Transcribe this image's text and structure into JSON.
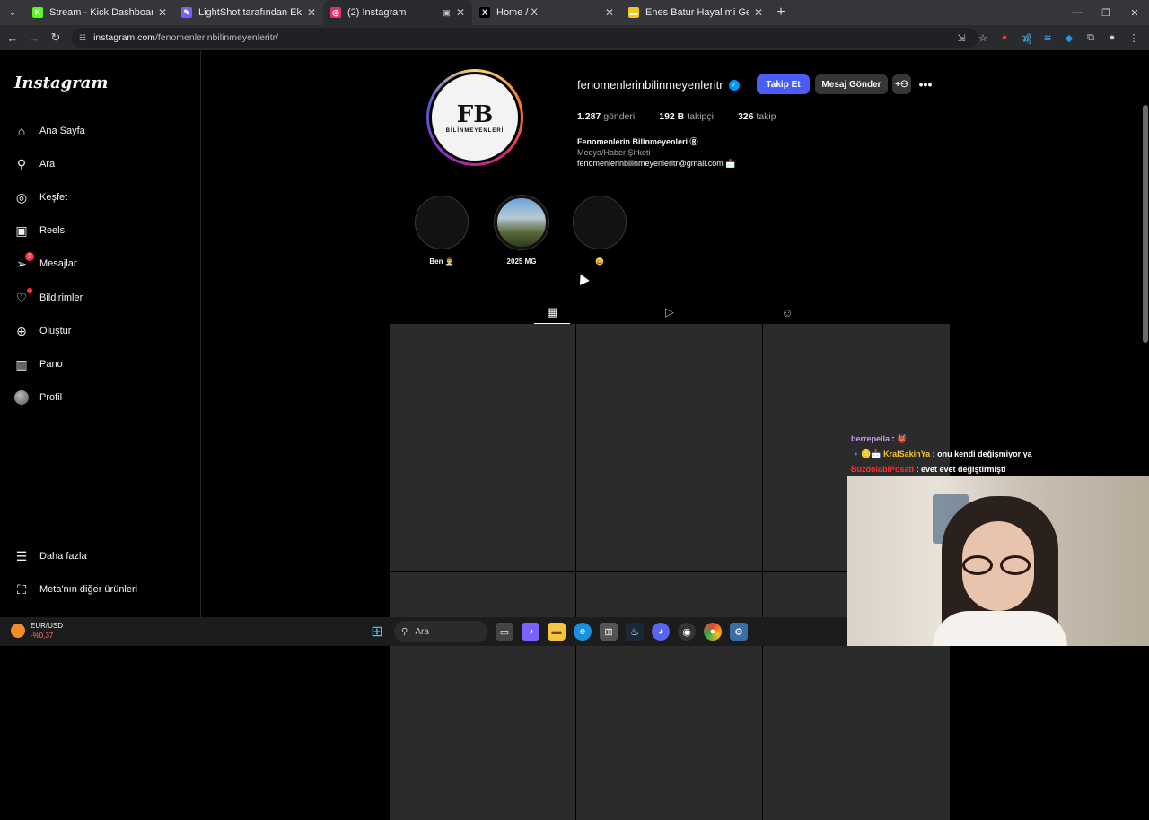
{
  "browser": {
    "tabs": [
      {
        "label": "Stream - Kick Dashboard",
        "fav_color": "#53fc18",
        "fav_glyph": "K",
        "close": "✕"
      },
      {
        "label": "LightShot tarafından Ekran Gör",
        "fav_color": "#7a5cff",
        "fav_glyph": "✎",
        "close": "✕"
      },
      {
        "label": "(2) Instagram",
        "fav_color": "#e1306c",
        "fav_glyph": "◎",
        "close": "✕"
      },
      {
        "label": "Home / X",
        "fav_color": "#000000",
        "fav_glyph": "X",
        "close": "✕"
      },
      {
        "label": "Enes Batur Hayal mi Gerçek Mi",
        "fav_color": "#f5c518",
        "fav_glyph": "▬",
        "close": "✕"
      }
    ],
    "new_tab": "+",
    "url_host": "instagram.com",
    "url_path": "/fenomenlerinbilinmeyenleritr/"
  },
  "sidebar": {
    "logo": "Instagram",
    "items": [
      {
        "label": "Ana Sayfa",
        "icon": "⌂",
        "icon_name": "home-icon"
      },
      {
        "label": "Ara",
        "icon": "⚲",
        "icon_name": "search-icon"
      },
      {
        "label": "Keşfet",
        "icon": "◎",
        "icon_name": "compass-icon"
      },
      {
        "label": "Reels",
        "icon": "▣",
        "icon_name": "reels-icon"
      },
      {
        "label": "Mesajlar",
        "icon": "➢",
        "icon_name": "messenger-icon",
        "badge": "2"
      },
      {
        "label": "Bildirimler",
        "icon": "♡",
        "icon_name": "heart-icon"
      },
      {
        "label": "Oluştur",
        "icon": "⊕",
        "icon_name": "create-icon"
      },
      {
        "label": "Pano",
        "icon": "▥",
        "icon_name": "dashboard-icon"
      },
      {
        "label": "Profil",
        "icon_name": "avatar"
      }
    ],
    "more": "Daha fazla",
    "meta": "Meta'nın diğer ürünleri"
  },
  "profile": {
    "username": "fenomenlerinbilinmeyenleritr",
    "verified": "✓",
    "follow_btn": "Takip Et",
    "message_btn": "Mesaj Gönder",
    "add_btn": "+⚇",
    "more_btn": "•••",
    "posts_count": "1.287",
    "posts_label": "gönderi",
    "followers_count": "192 B",
    "followers_label": "takipçi",
    "following_count": "326",
    "following_label": "takip",
    "display_name": "Fenomenlerin Bilinmeyenleri Ⓡ",
    "category": "Medya/Haber Şirketi",
    "email": "fenomenlerinbilinmeyenleritr@gmail.com 📩",
    "pic_letters": "FB",
    "pic_ring": "BİLİNMEYENLERİ"
  },
  "highlights": [
    {
      "label": "Ben 👨‍💼"
    },
    {
      "label": "2025 MG"
    },
    {
      "label": "😄"
    }
  ],
  "profile_tabs": [
    {
      "icon": "▦",
      "name": "posts-tab-icon"
    },
    {
      "icon": "▷",
      "name": "reels-tab-icon"
    },
    {
      "icon": "☺",
      "name": "tagged-tab-icon"
    }
  ],
  "chat": [
    {
      "user": "berrepella",
      "text": " : 👹"
    },
    {
      "user": "KralSakinYa",
      "text": " : onu kendi değişmiyor ya",
      "prefix": "🔹🪙📩 "
    },
    {
      "user": "BuzdolabiPosati",
      "text": " : evet evet değiştirmişti"
    }
  ],
  "taskbar": {
    "pair": "EUR/USD",
    "change": "-%0,37",
    "search": "Ara"
  }
}
